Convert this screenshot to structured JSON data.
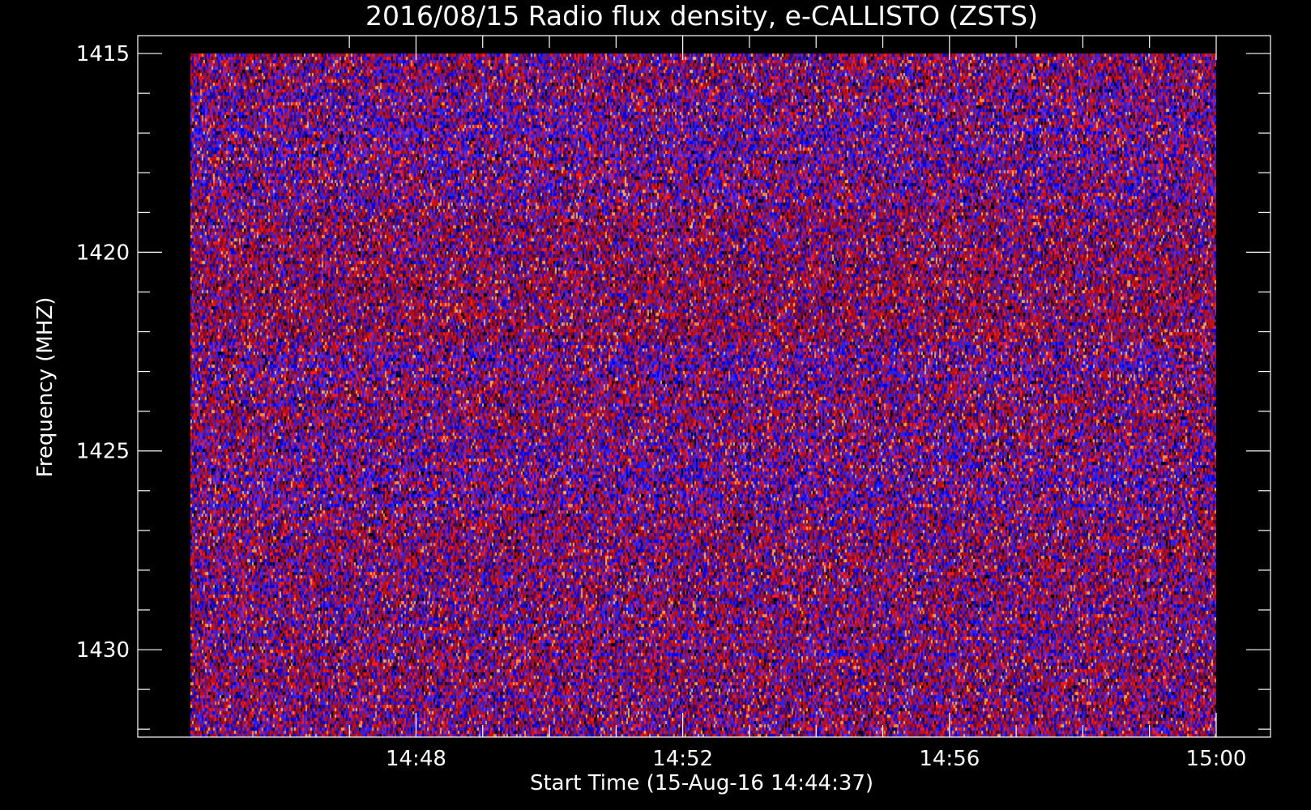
{
  "chart_data": {
    "type": "heatmap",
    "title": "2016/08/15  Radio flux density, e-CALLISTO (ZSTS)",
    "xlabel": "Start Time (15-Aug-16 14:44:37)",
    "ylabel": "Frequency (MHZ)",
    "x_range": [
      "14:44:37",
      "15:00:00"
    ],
    "x_tick_labels": [
      "14:48",
      "14:52",
      "14:56",
      "15:00"
    ],
    "x_ticks_minutes": [
      47,
      48,
      49,
      50,
      51,
      52,
      53,
      54,
      55,
      56,
      57,
      58,
      59,
      60
    ],
    "x_major_minutes": [
      48,
      52,
      56,
      60
    ],
    "y_range": [
      1414.55,
      1432.2
    ],
    "y_data_range": [
      1415,
      1432.2
    ],
    "y_tick_labels": [
      "1415",
      "1420",
      "1425",
      "1430"
    ],
    "y_ticks": [
      1415,
      1416,
      1417,
      1418,
      1419,
      1420,
      1421,
      1422,
      1423,
      1424,
      1425,
      1426,
      1427,
      1428,
      1429,
      1430,
      1431,
      1432
    ],
    "y_major": [
      1415,
      1420,
      1425,
      1430
    ],
    "y_reversed": true,
    "colormap": [
      "#000000",
      "#3a0a55",
      "#5a1aa0",
      "#7a28c8",
      "#2222ff",
      "#0000ee",
      "#8a0a2a",
      "#c01010",
      "#ff1a1a",
      "#ff8a3a",
      "#f0b060"
    ],
    "background": "#000000",
    "foreground": "#ffffff"
  }
}
